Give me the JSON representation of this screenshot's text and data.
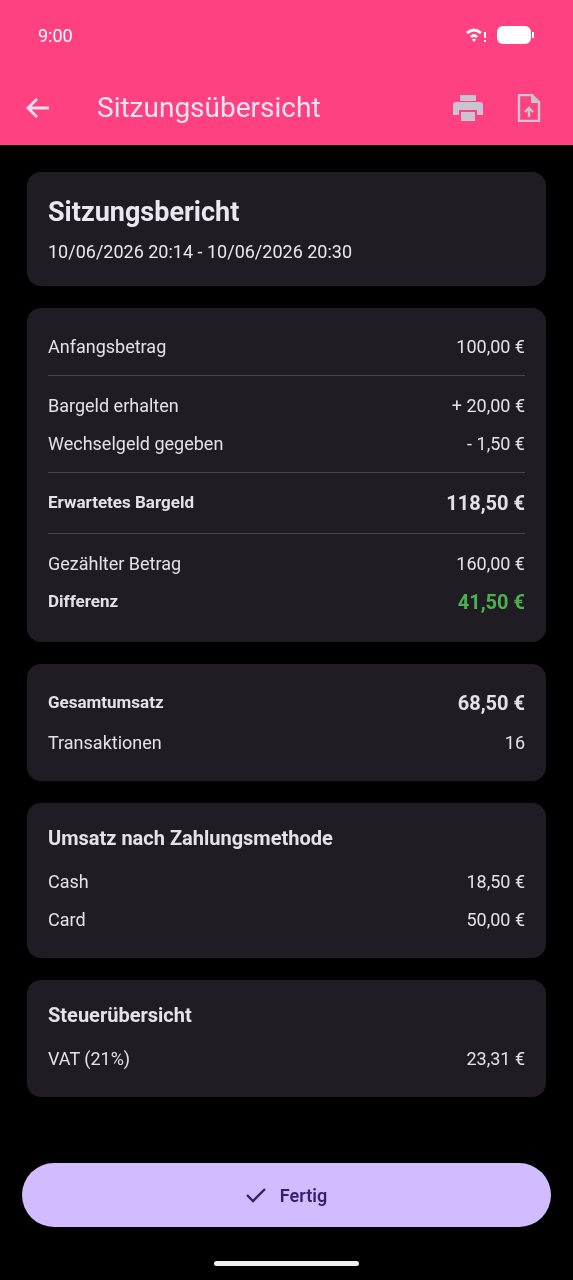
{
  "status_bar": {
    "time": "9:00"
  },
  "app_bar": {
    "title": "Sitzungsübersicht"
  },
  "header_card": {
    "title": "Sitzungsbericht",
    "subtitle": "10/06/2026 20:14 - 10/06/2026 20:30"
  },
  "cards": [
    {
      "rows": [
        {
          "kind": "normal",
          "label": "Anfangsbetrag",
          "value": "100,00 €"
        },
        {
          "kind": "divider"
        },
        {
          "kind": "normal",
          "label": "Bargeld erhalten",
          "value": "+ 20,00 €"
        },
        {
          "kind": "normal",
          "label": "Wechselgeld gegeben",
          "value": "- 1,50 €"
        },
        {
          "kind": "divider"
        },
        {
          "kind": "total",
          "label": "Erwartetes Bargeld",
          "value": "118,50 €"
        },
        {
          "kind": "divider"
        },
        {
          "kind": "normal",
          "label": "Gezählter Betrag",
          "value": "160,00 €"
        },
        {
          "kind": "positive",
          "label": "Differenz",
          "value": "41,50 €"
        }
      ]
    },
    {
      "rows": [
        {
          "kind": "total",
          "label": "Gesamtumsatz",
          "value": "68,50 €"
        },
        {
          "kind": "normal",
          "label": "Transaktionen",
          "value": "16"
        }
      ]
    },
    {
      "title": "Umsatz nach Zahlungsmethode",
      "rows": [
        {
          "kind": "normal",
          "label": "Cash",
          "value": "18,50 €"
        },
        {
          "kind": "normal",
          "label": "Card",
          "value": "50,00 €"
        }
      ]
    },
    {
      "title": "Steuerübersicht",
      "rows": [
        {
          "kind": "normal",
          "label": "VAT (21%)",
          "value": "23,31 €"
        }
      ]
    }
  ],
  "done_button": {
    "label": "Fertig"
  }
}
